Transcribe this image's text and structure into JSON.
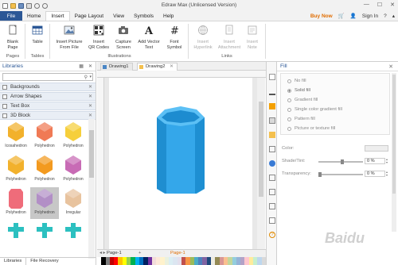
{
  "window": {
    "title": "Edraw Max (Unlicensed Version)",
    "controls": [
      "—",
      "☐",
      "✕"
    ]
  },
  "menu": {
    "file": "File",
    "tabs": [
      "Home",
      "Insert",
      "Page Layout",
      "View",
      "Symbols",
      "Help"
    ],
    "active_tab": "Insert",
    "buy_now": "Buy Now",
    "sign_in": "Sign In"
  },
  "ribbon": {
    "pages": {
      "btn": "Blank\nPage",
      "group": "Pages"
    },
    "tables": {
      "btn": "Table",
      "group": "Tables"
    },
    "illustrations": {
      "group": "Illustrations",
      "buttons": [
        "Insert Picture\nFrom File",
        "Insert\nQR Codes",
        "Capture\nScreen",
        "Add Vector\nText",
        "Font\nSymbol"
      ]
    },
    "links": {
      "group": "Links",
      "buttons": [
        "Insert\nHyperlink",
        "Insert\nAttachment",
        "Insert\nNote"
      ]
    }
  },
  "libraries": {
    "title": "Libraries",
    "categories": [
      "Backgrounds",
      "Arrow Shapes",
      "Text Box",
      "3D Block"
    ],
    "shapes": [
      {
        "label": "Icosahedron",
        "color": "#f2b12c"
      },
      {
        "label": "Polyhedron",
        "color": "#f07a55"
      },
      {
        "label": "Polyhedron",
        "color": "#f6cf3b"
      },
      {
        "label": "Polyhedron",
        "color": "#f2b12c"
      },
      {
        "label": "Polyhedron",
        "color": "#f39a1f"
      },
      {
        "label": "Polyhedron",
        "color": "#c86bb5"
      },
      {
        "label": "Polyhedron",
        "color": "#ef6c7a"
      },
      {
        "label": "Polyhedron",
        "color": "#b28fc6"
      },
      {
        "label": "Irregular",
        "color": "#e8c39e"
      },
      {
        "label": "",
        "color": "#2cc0c0"
      },
      {
        "label": "",
        "color": "#2cc0c0"
      },
      {
        "label": "",
        "color": "#2cc0c0"
      }
    ],
    "bottom_tabs": [
      "Libraries",
      "File Recovery"
    ]
  },
  "documents": {
    "tabs": [
      "Drawing1",
      "Drawing2"
    ],
    "active": "Drawing2",
    "pages": [
      "Page-1",
      "Page-1"
    ],
    "shape_color": "#2d9fe0"
  },
  "fill_panel": {
    "title": "Fill",
    "options": [
      "No fill",
      "Solid fill",
      "Gradient fill",
      "Single color gradient fill",
      "Pattern fill",
      "Picture or texture fill"
    ],
    "selected": "Solid fill",
    "color_label": "Color:",
    "shade_label": "Shade/Tint:",
    "shade_value": "0 %",
    "transparency_label": "Transparency:",
    "transparency_value": "0 %"
  },
  "watermark": "Baidu"
}
